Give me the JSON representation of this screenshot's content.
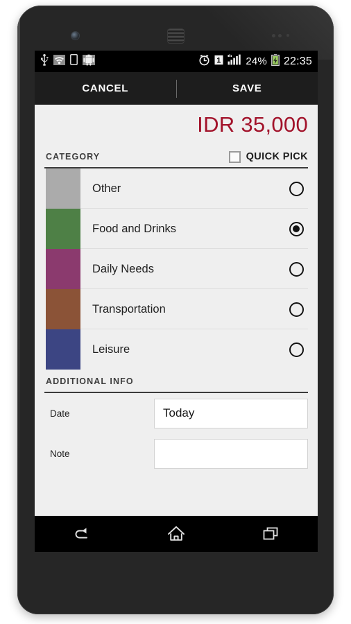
{
  "status_bar": {
    "left_icons": [
      "usb-icon",
      "wifi-icon",
      "device-icon",
      "android-icon"
    ],
    "alarm_icon": "alarm-clock-icon",
    "sim_indicator": "1",
    "signal_icon": "signal-bars-icon",
    "battery_percent": "24%",
    "battery_icon": "battery-charging-icon",
    "time": "22:35"
  },
  "action_bar": {
    "cancel_label": "CANCEL",
    "save_label": "SAVE"
  },
  "amount": {
    "value": "IDR 35,000",
    "color": "#a2122a"
  },
  "category_section": {
    "title": "CATEGORY",
    "quick_pick_label": "QUICK PICK",
    "quick_pick_checked": false,
    "items": [
      {
        "label": "Other",
        "color": "#ababab",
        "selected": false
      },
      {
        "label": "Food and Drinks",
        "color": "#4e8046",
        "selected": true
      },
      {
        "label": "Daily Needs",
        "color": "#8b3a6e",
        "selected": false
      },
      {
        "label": "Transportation",
        "color": "#8b5337",
        "selected": false
      },
      {
        "label": "Leisure",
        "color": "#3c4583",
        "selected": false
      }
    ]
  },
  "additional_info": {
    "title": "ADDITIONAL INFO",
    "rows": [
      {
        "label": "Date",
        "value": "Today"
      },
      {
        "label": "Note",
        "value": ""
      }
    ]
  },
  "nav_bar": {
    "back_label": "back-icon",
    "home_label": "home-icon",
    "recents_label": "recents-icon"
  }
}
